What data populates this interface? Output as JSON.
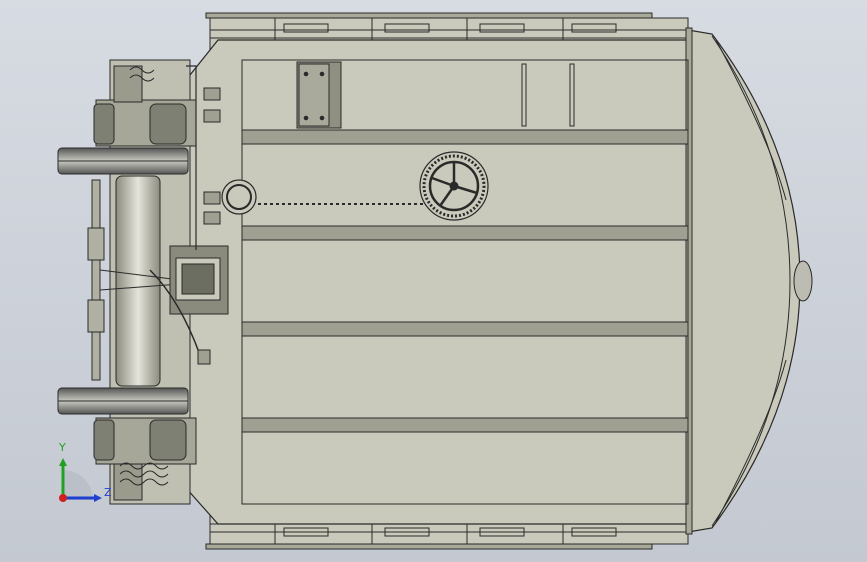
{
  "viewport": {
    "background_top": "#d7dbe2",
    "background_bottom": "#c4c9d1",
    "model_fill": "#c9cabb",
    "model_edge": "#2a2a2a",
    "rail_fill": "#a8a999"
  },
  "triad": {
    "y_label": "Y",
    "z_label": "Z",
    "y_color": "#22a022",
    "z_color": "#1f3fd0",
    "x_color": "#d01f1f"
  }
}
